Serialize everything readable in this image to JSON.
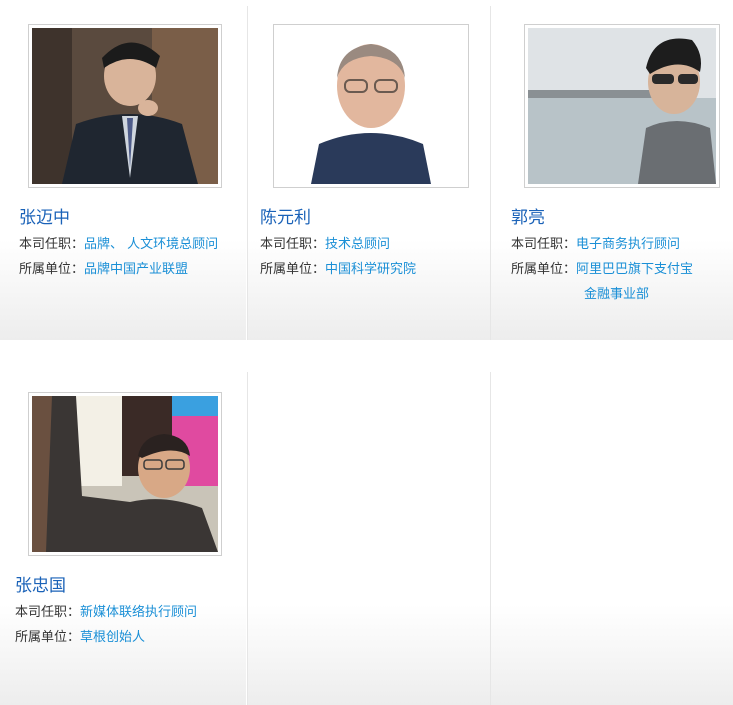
{
  "labels": {
    "position": "本司任职：",
    "affiliation": "所属单位："
  },
  "people": [
    {
      "name": "张迈中",
      "position": "品牌、 人文环境总顾问",
      "affiliation": "品牌中国产业联盟"
    },
    {
      "name": "陈元利",
      "position": "技术总顾问",
      "affiliation": "中国科学研究院"
    },
    {
      "name": "郭亮",
      "position": "电子商务执行顾问",
      "affiliation": "阿里巴巴旗下支付宝",
      "affiliation_line2": "金融事业部"
    },
    {
      "name": "张忠国",
      "position": "新媒体联络执行顾问",
      "affiliation": "草根创始人"
    }
  ],
  "colors": {
    "name": "#1a62b8",
    "value": "#1a8fd6",
    "label": "#333333"
  }
}
